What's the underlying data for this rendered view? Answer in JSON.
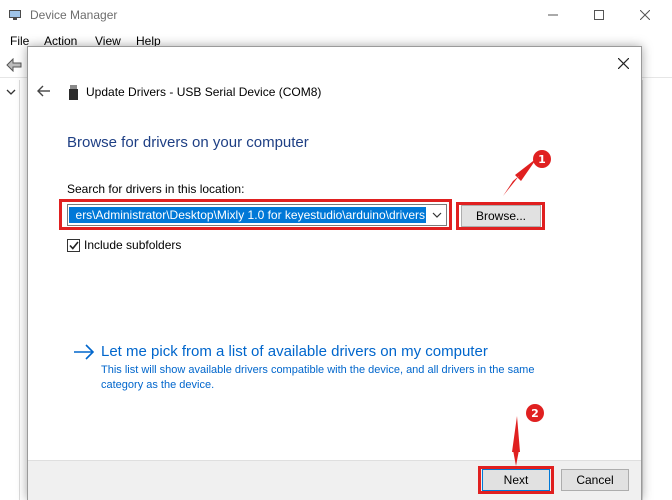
{
  "window": {
    "title": "Device Manager",
    "menu": [
      "File",
      "Action",
      "View",
      "Help"
    ]
  },
  "dialog": {
    "title": "Update Drivers - USB Serial Device (COM8)",
    "heading": "Browse for drivers on your computer",
    "search_label": "Search for drivers in this location:",
    "path_value": "ers\\Administrator\\Desktop\\Mixly 1.0 for keyestudio\\arduino\\drivers",
    "browse_label": "Browse...",
    "include_subfolders_label": "Include subfolders",
    "include_subfolders_checked": true,
    "pick_link_text": "Let me pick from a list of available drivers on my computer",
    "pick_desc": "This list will show available drivers compatible with the device, and all drivers in the same category as the device.",
    "next_label": "Next",
    "cancel_label": "Cancel"
  },
  "annotations": {
    "marker_1": "1",
    "marker_2": "2",
    "highlight_color": "#e02020"
  },
  "colors": {
    "heading": "#1e3f84",
    "link": "#0066cc",
    "selection": "#0078d7"
  },
  "icons": {
    "app": "device-manager-icon",
    "back": "back-arrow-icon",
    "device": "usb-device-icon",
    "close": "close-icon",
    "dropdown": "chevron-down-icon",
    "checkbox": "checkmark-icon",
    "link_arrow": "right-arrow-icon"
  }
}
